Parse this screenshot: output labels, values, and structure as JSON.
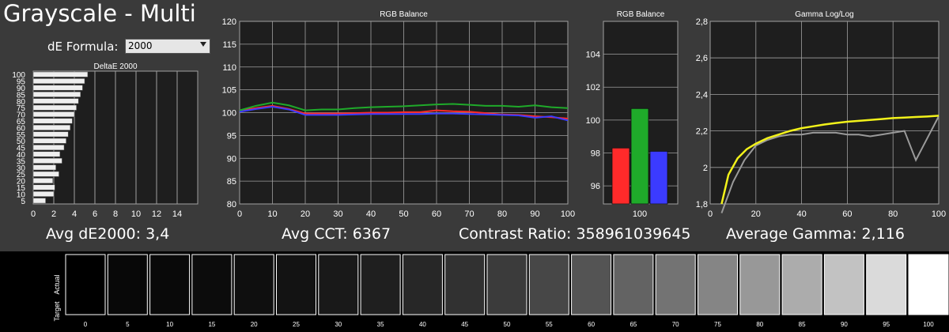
{
  "page_title": "Grayscale - Multi",
  "de_formula": {
    "label": "dE Formula:",
    "value": "2000"
  },
  "stats": {
    "avg_de": "Avg dE2000: 3,4",
    "avg_cct": "Avg CCT: 6367",
    "contrast": "Contrast Ratio: 358961039645",
    "avg_gamma": "Average Gamma: 2,116"
  },
  "colors": {
    "panel_bg": "#1e1e1e",
    "grid": "#a0a0a0",
    "red": "#ff2a2a",
    "green": "#1faa2a",
    "blue": "#3b3bff",
    "gamma_target": "#f2f21a",
    "gamma_actual": "#9a9a9a"
  },
  "chart_data": [
    {
      "type": "bar",
      "orientation": "horizontal",
      "title": "DeltaE 2000",
      "categories": [
        5,
        10,
        15,
        20,
        25,
        30,
        35,
        40,
        45,
        50,
        55,
        60,
        65,
        70,
        75,
        80,
        85,
        90,
        95,
        100
      ],
      "values": [
        1.2,
        2.0,
        2.1,
        1.9,
        2.5,
        2.2,
        2.8,
        2.6,
        3.0,
        3.2,
        3.4,
        3.6,
        3.8,
        4.0,
        4.2,
        4.4,
        4.6,
        4.8,
        5.0,
        5.3
      ],
      "xlim": [
        0,
        16
      ],
      "xticks": [
        0,
        2,
        4,
        6,
        8,
        10,
        12,
        14
      ],
      "yticks": [
        5,
        10,
        15,
        20,
        25,
        30,
        35,
        40,
        45,
        50,
        55,
        60,
        65,
        70,
        75,
        80,
        85,
        90,
        95,
        100
      ]
    },
    {
      "type": "line",
      "title": "RGB Balance",
      "x": [
        0,
        5,
        10,
        15,
        20,
        25,
        30,
        35,
        40,
        45,
        50,
        55,
        60,
        65,
        70,
        75,
        80,
        85,
        90,
        95,
        100
      ],
      "series": [
        {
          "name": "Red",
          "values": [
            100.5,
            101.0,
            101.5,
            100.8,
            99.8,
            99.8,
            99.8,
            99.9,
            100.0,
            100.0,
            100.1,
            100.1,
            100.5,
            100.3,
            100.2,
            99.9,
            99.6,
            99.5,
            99.2,
            99.0,
            98.7
          ]
        },
        {
          "name": "Green",
          "values": [
            100.5,
            101.5,
            102.2,
            101.6,
            100.5,
            100.7,
            100.7,
            101.0,
            101.2,
            101.3,
            101.4,
            101.6,
            101.8,
            101.9,
            101.7,
            101.5,
            101.5,
            101.3,
            101.6,
            101.2,
            101.0
          ]
        },
        {
          "name": "Blue",
          "values": [
            100.2,
            100.8,
            101.3,
            100.7,
            99.5,
            99.5,
            99.5,
            99.6,
            99.7,
            99.7,
            99.7,
            99.7,
            99.8,
            99.8,
            99.7,
            99.6,
            99.5,
            99.4,
            98.9,
            99.2,
            98.3
          ]
        }
      ],
      "ylim": [
        80,
        120
      ],
      "yticks": [
        80,
        85,
        90,
        95,
        100,
        105,
        110,
        115,
        120
      ],
      "xticks": [
        0,
        10,
        20,
        30,
        40,
        50,
        60,
        70,
        80,
        90,
        100
      ]
    },
    {
      "type": "bar",
      "title": "RGB Balance",
      "categories": [
        "100"
      ],
      "series": [
        {
          "name": "Red",
          "values": [
            98.3
          ]
        },
        {
          "name": "Green",
          "values": [
            100.7
          ]
        },
        {
          "name": "Blue",
          "values": [
            98.1
          ]
        }
      ],
      "ylim": [
        94.9,
        106
      ],
      "yticks": [
        96,
        98,
        100,
        102,
        104
      ]
    },
    {
      "type": "line",
      "title": "Gamma Log/Log",
      "x_target": [
        5,
        8,
        12,
        16,
        20,
        25,
        30,
        35,
        40,
        45,
        50,
        55,
        60,
        65,
        70,
        75,
        80,
        85,
        90,
        95,
        100
      ],
      "target": [
        1.8,
        1.96,
        2.05,
        2.1,
        2.13,
        2.16,
        2.18,
        2.2,
        2.215,
        2.225,
        2.235,
        2.243,
        2.25,
        2.255,
        2.26,
        2.265,
        2.27,
        2.273,
        2.276,
        2.279,
        2.283
      ],
      "x_actual": [
        5,
        10,
        15,
        20,
        25,
        30,
        35,
        40,
        45,
        50,
        55,
        60,
        65,
        70,
        75,
        80,
        85,
        90,
        95,
        100
      ],
      "actual": [
        1.75,
        1.92,
        2.04,
        2.12,
        2.15,
        2.17,
        2.18,
        2.18,
        2.19,
        2.19,
        2.19,
        2.18,
        2.18,
        2.17,
        2.18,
        2.19,
        2.2,
        2.04,
        2.16,
        2.28
      ],
      "ylim": [
        1.8,
        2.8
      ],
      "yticks": [
        "1,8",
        "2",
        "2,2",
        "2,4",
        "2,6",
        "2,8"
      ],
      "xticks": [
        0,
        20,
        40,
        60,
        80,
        100
      ]
    }
  ],
  "patches": {
    "actual_label": "Actual",
    "target_label": "Target",
    "levels": [
      0,
      5,
      10,
      15,
      20,
      25,
      30,
      35,
      40,
      45,
      50,
      55,
      60,
      65,
      70,
      75,
      80,
      85,
      90,
      95,
      100
    ],
    "labels": [
      "0",
      "5",
      "10",
      "15",
      "20",
      "25",
      "30",
      "35",
      "40",
      "45",
      "50",
      "55",
      "60",
      "65",
      "70",
      "75",
      "80",
      "85",
      "90",
      "95",
      "100"
    ]
  }
}
